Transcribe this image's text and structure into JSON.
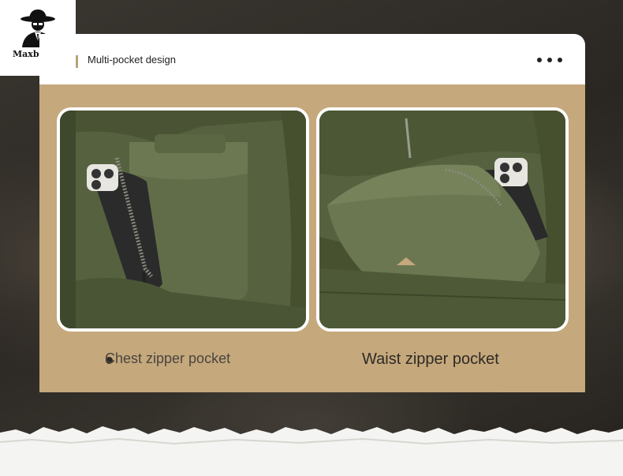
{
  "brand": {
    "name": "Maxbarley",
    "logo_icon": "hat-man-icon"
  },
  "header": {
    "title": "Multi-pocket design",
    "menu_icon": "more-horizontal-icon"
  },
  "features": [
    {
      "caption": "Chest zipper pocket",
      "image": "chest-pocket-photo"
    },
    {
      "caption": "Waist zipper pocket",
      "image": "waist-pocket-photo"
    }
  ],
  "colors": {
    "panel": "#c5a87c",
    "accent": "#b8a27a",
    "fabric": "#56613f"
  }
}
